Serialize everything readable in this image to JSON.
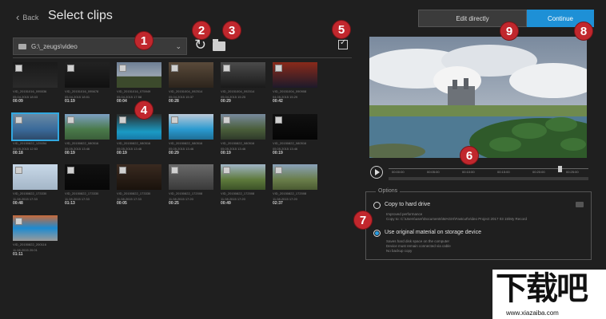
{
  "header": {
    "back_label": "Back",
    "title": "Select clips"
  },
  "toolbar": {
    "path": "G:\\_zeugs\\video"
  },
  "clips": [
    {
      "meta1": "VID_20151016_095536",
      "meta2": "05.04.2015 18:03",
      "dur": "00:09"
    },
    {
      "meta1": "VID_20151016_095678",
      "meta2": "05.04.2015 18:01",
      "dur": "01:19"
    },
    {
      "meta1": "VID_20151016_075949",
      "meta2": "05.04.2015 17:58",
      "dur": "00:04"
    },
    {
      "meta1": "VID_20151004_092514",
      "meta2": "05.04.2015 15:37",
      "dur": "00:28"
    },
    {
      "meta1": "VID_20151004_092014",
      "meta2": "05.04.2015 15:25",
      "dur": "00:29"
    },
    {
      "meta1": "VID_20151004_090908",
      "meta2": "04.05.2015 15:29",
      "dur": "00:42"
    },
    {
      "meta1": "VID_20150822_125054",
      "meta2": "05.05.2015 12:53",
      "dur": "00:18"
    },
    {
      "meta1": "VID_20150822_080516",
      "meta2": "05.05.2015 13:46",
      "dur": "00:19"
    },
    {
      "meta1": "VID_20150822_080516",
      "meta2": "05.05.2015 13:46",
      "dur": "00:19"
    },
    {
      "meta1": "VID_20150822_080516",
      "meta2": "05.05.2015 13:46",
      "dur": "00:29"
    },
    {
      "meta1": "VID_20150822_080516",
      "meta2": "05.05.2015 13:46",
      "dur": "00:19"
    },
    {
      "meta1": "VID_20150822_080516",
      "meta2": "05.05.2015 13:46",
      "dur": "00:19"
    },
    {
      "meta1": "VID_20150822_173330",
      "meta2": "11.08.2015 17:33",
      "dur": "00:48"
    },
    {
      "meta1": "VID_20150822_173330",
      "meta2": "11.08.2015 17:33",
      "dur": "01:13"
    },
    {
      "meta1": "VID_20150822_173330",
      "meta2": "11.08.2015 17:33",
      "dur": "00:05"
    },
    {
      "meta1": "VID_20150822_172008",
      "meta2": "11.08.2015 17:20",
      "dur": "00:25"
    },
    {
      "meta1": "VID_20150822_172008",
      "meta2": "11.08.2015 17:20",
      "dur": "00:49"
    },
    {
      "meta1": "VID_20150822_172008",
      "meta2": "11.08.2015 17:20",
      "dur": "02:37"
    },
    {
      "meta1": "VID_20150822_200116",
      "meta2": "11.08.2015 20:01",
      "dur": "01:11"
    }
  ],
  "actions": {
    "edit_directly": "Edit directly",
    "continue": "Continue"
  },
  "timeline": {
    "ticks": [
      "00:00:00",
      "00:05:00",
      "00:10:00",
      "00:15:00",
      "00:20:00",
      "00:25:00"
    ]
  },
  "options": {
    "title": "Options",
    "copy_label": "Copy to hard drive",
    "copy_sub1": "Improved performance",
    "copy_sub2": "Copy to: C:\\Users\\user\\Documents\\MAGIX\\Fastcut\\Video Project 2017 03 15\\My Record",
    "use_label": "Use original material on storage device",
    "use_sub1": "Saves hard disk space on the computer",
    "use_sub2": "Device must remain connected via cable",
    "use_sub3": "No backup copy"
  },
  "badges": [
    "1",
    "2",
    "3",
    "4",
    "5",
    "6",
    "7",
    "8",
    "9"
  ],
  "watermark": {
    "logo": "下载吧",
    "url": "www.xiazaiba.com"
  },
  "colors": {
    "accent": "#1e90d6",
    "badge": "#c1272d",
    "background": "#1f1f1f"
  }
}
